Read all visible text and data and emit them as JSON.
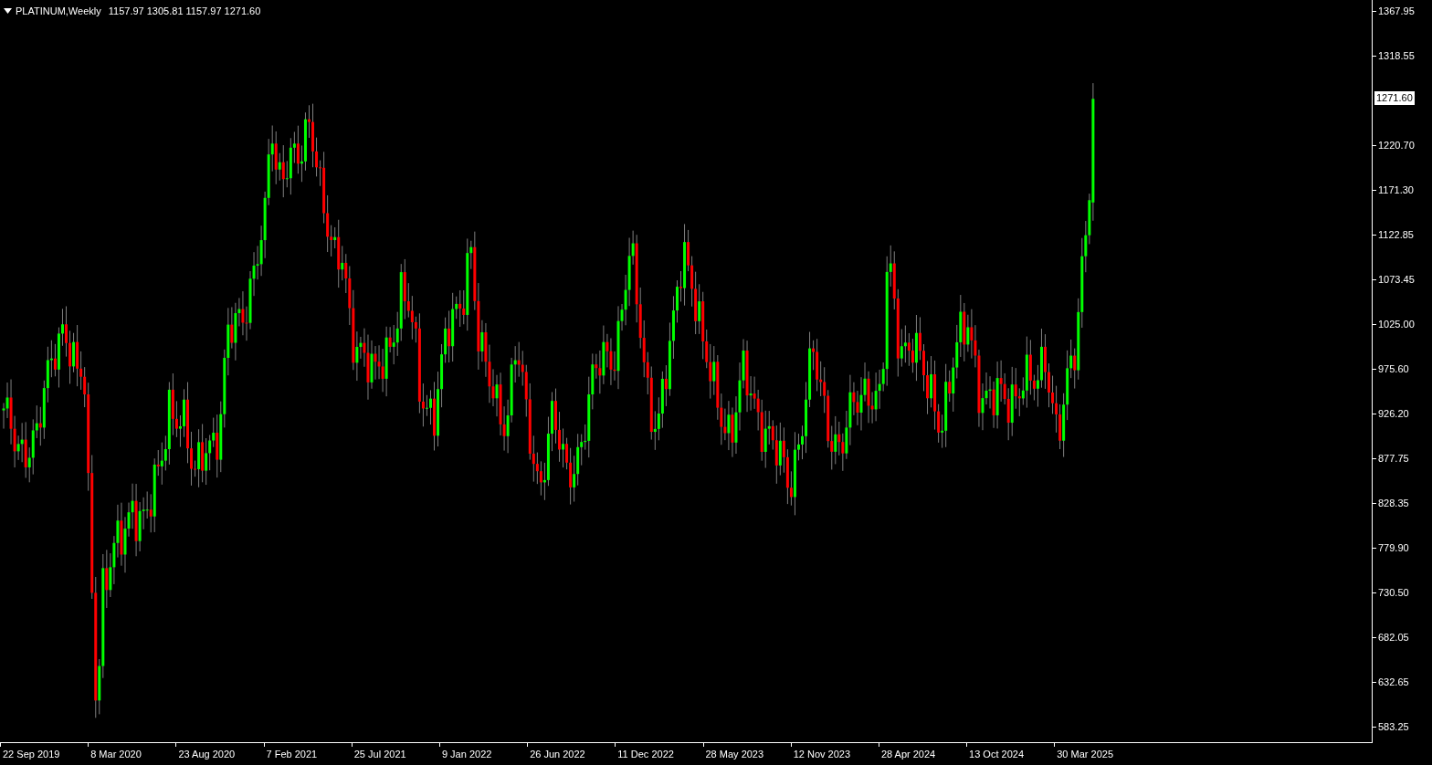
{
  "chart": {
    "symbol": "PLATINUM,Weekly",
    "ohlc": [
      "1157.97",
      "1305.81",
      "1157.97",
      "1271.60"
    ],
    "price_axis": [
      {
        "label": "1367.95",
        "kind": "tick"
      },
      {
        "label": "1318.55",
        "kind": "tick"
      },
      {
        "label": "1271.60",
        "kind": "current"
      },
      {
        "label": "1220.70",
        "kind": "tick"
      },
      {
        "label": "1171.30",
        "kind": "tick"
      },
      {
        "label": "1122.85",
        "kind": "tick"
      },
      {
        "label": "1073.45",
        "kind": "tick"
      },
      {
        "label": "1025.00",
        "kind": "tick"
      },
      {
        "label": "975.60",
        "kind": "tick"
      },
      {
        "label": "926.20",
        "kind": "tick"
      },
      {
        "label": "877.75",
        "kind": "tick"
      },
      {
        "label": "828.35",
        "kind": "tick"
      },
      {
        "label": "779.90",
        "kind": "tick"
      },
      {
        "label": "730.50",
        "kind": "tick"
      },
      {
        "label": "682.05",
        "kind": "tick"
      },
      {
        "label": "632.65",
        "kind": "tick"
      },
      {
        "label": "583.25",
        "kind": "tick"
      }
    ],
    "time_axis": [
      "22 Sep 2019",
      "8 Mar 2020",
      "23 Aug 2020",
      "7 Feb 2021",
      "25 Jul 2021",
      "9 Jan 2022",
      "26 Jun 2022",
      "11 Dec 2022",
      "28 May 2023",
      "12 Nov 2023",
      "28 Apr 2024",
      "13 Oct 2024",
      "30 Mar 2025"
    ]
  }
}
